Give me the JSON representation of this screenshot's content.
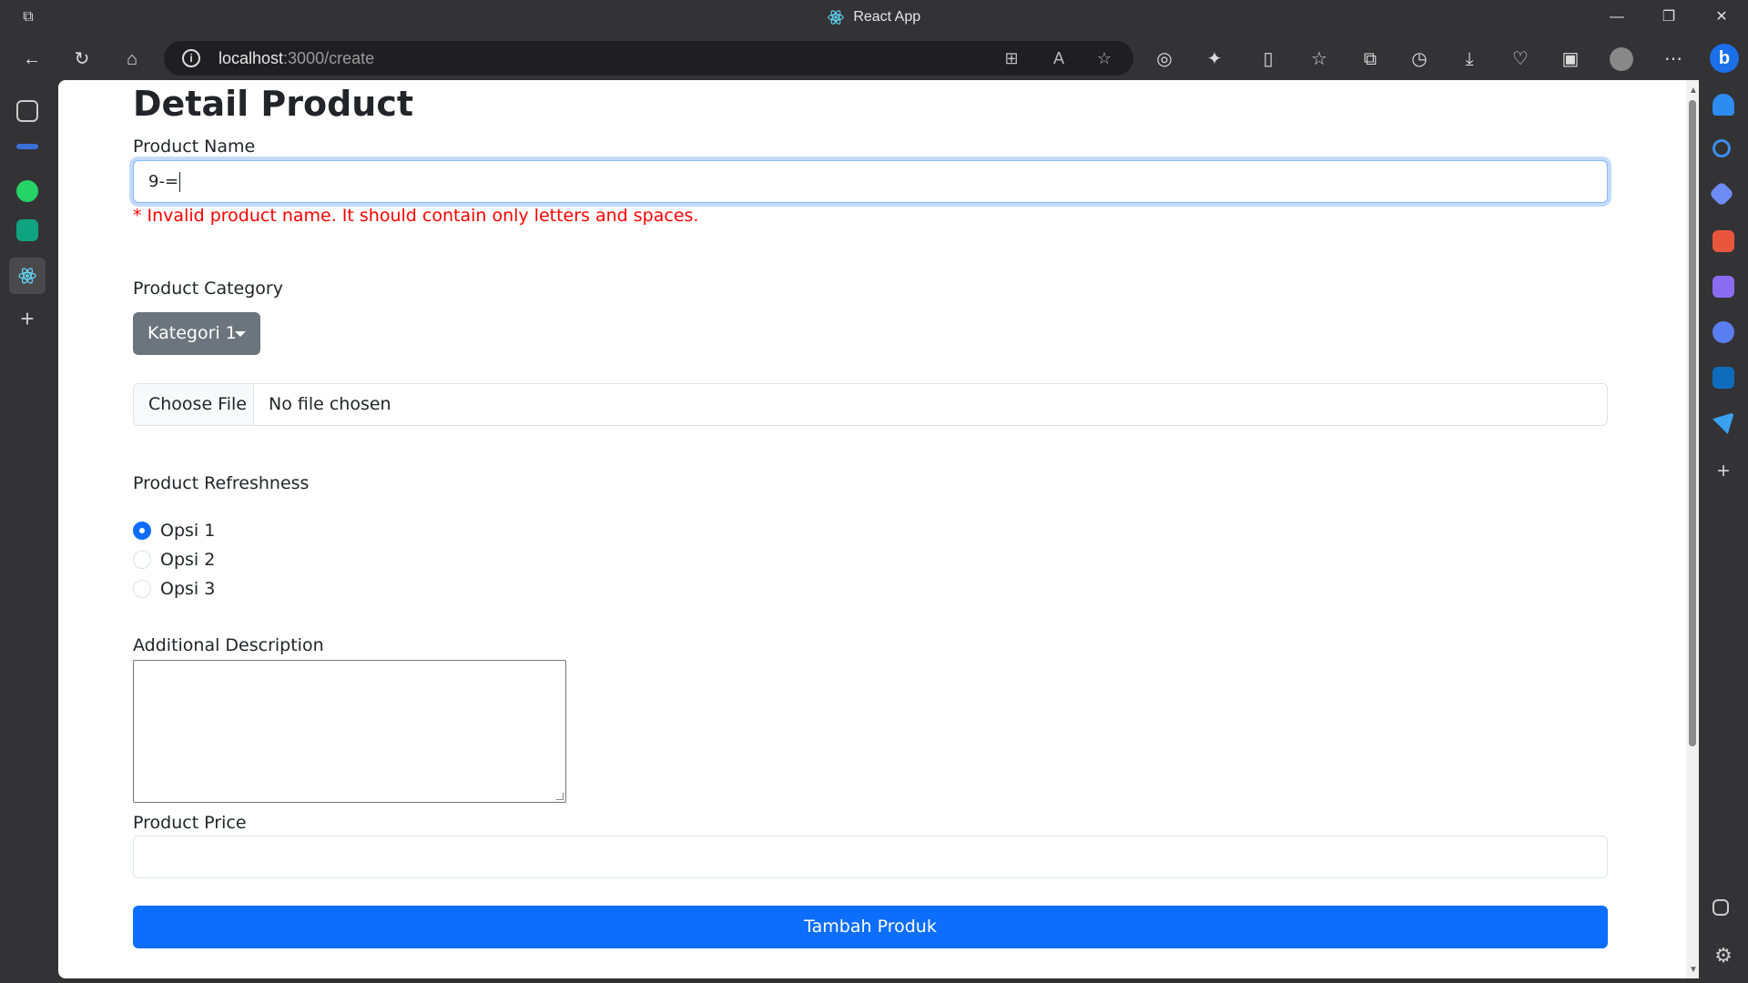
{
  "browser": {
    "window_title": "React App",
    "url_host": "localhost",
    "url_rest": ":3000/create"
  },
  "page": {
    "heading": "Detail Product",
    "product_name": {
      "label": "Product Name",
      "value": "9-=",
      "error": "* Invalid product name. It should contain only letters and spaces."
    },
    "product_category": {
      "label": "Product Category",
      "selected": "Kategori 1"
    },
    "file": {
      "button_label": "Choose File",
      "status": "No file chosen"
    },
    "product_freshness": {
      "label": "Product Refreshness",
      "options": [
        {
          "label": "Opsi 1",
          "checked": true
        },
        {
          "label": "Opsi 2",
          "checked": false
        },
        {
          "label": "Opsi 3",
          "checked": false
        }
      ]
    },
    "additional_description": {
      "label": "Additional Description",
      "value": ""
    },
    "product_price": {
      "label": "Product Price",
      "value": ""
    },
    "submit_label": "Tambah Produk"
  },
  "colors": {
    "primary": "#0d6efd",
    "secondary": "#6c757d",
    "error": "#ff0000",
    "chrome": "#333335"
  }
}
